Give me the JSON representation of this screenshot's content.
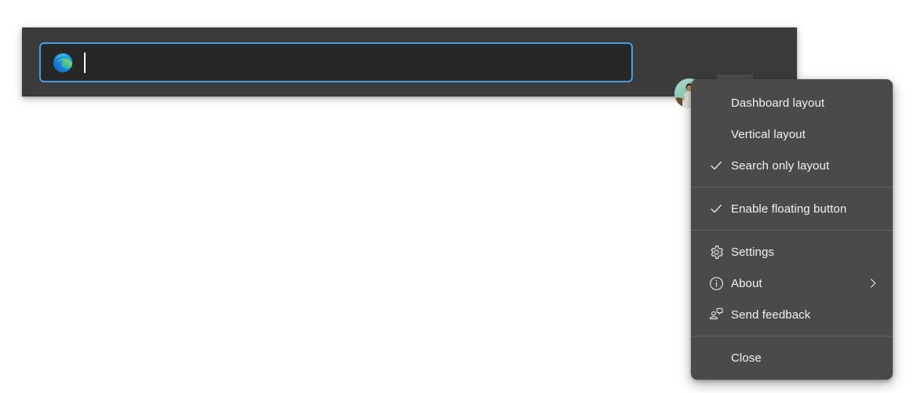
{
  "toolbar": {
    "search": {
      "value": "",
      "placeholder": "",
      "logo_icon": "edge-logo-icon",
      "caret_icon": "text-caret"
    },
    "avatar": {
      "icon": "avatar",
      "label": ""
    },
    "settings_button": {
      "icon": "gear-icon",
      "label": ""
    },
    "minimize_button": {
      "icon": "minimize-icon",
      "label": ""
    }
  },
  "menu": {
    "groups": [
      {
        "items": [
          {
            "label": "Dashboard layout",
            "lead_icon": "",
            "checked": false,
            "trail_icon": ""
          },
          {
            "label": "Vertical layout",
            "lead_icon": "",
            "checked": false,
            "trail_icon": ""
          },
          {
            "label": "Search only layout",
            "lead_icon": "check-icon",
            "checked": true,
            "trail_icon": ""
          }
        ]
      },
      {
        "items": [
          {
            "label": "Enable floating button",
            "lead_icon": "check-icon",
            "checked": true,
            "trail_icon": ""
          }
        ]
      },
      {
        "items": [
          {
            "label": "Settings",
            "lead_icon": "gear-icon",
            "checked": false,
            "trail_icon": ""
          },
          {
            "label": "About",
            "lead_icon": "info-circle-icon",
            "checked": false,
            "trail_icon": "chevron-right-icon"
          },
          {
            "label": "Send feedback",
            "lead_icon": "feedback-icon",
            "checked": false,
            "trail_icon": ""
          }
        ]
      },
      {
        "items": [
          {
            "label": "Close",
            "lead_icon": "",
            "checked": false,
            "trail_icon": ""
          }
        ]
      }
    ]
  },
  "colors": {
    "toolbar_bg": "#3b3b3b",
    "search_bg": "#272727",
    "search_border": "#4a9ee0",
    "menu_bg": "#4a4a4a",
    "menu_separator": "#626262",
    "menu_text": "#f2f2f2",
    "page_bg": "#ffffff"
  }
}
